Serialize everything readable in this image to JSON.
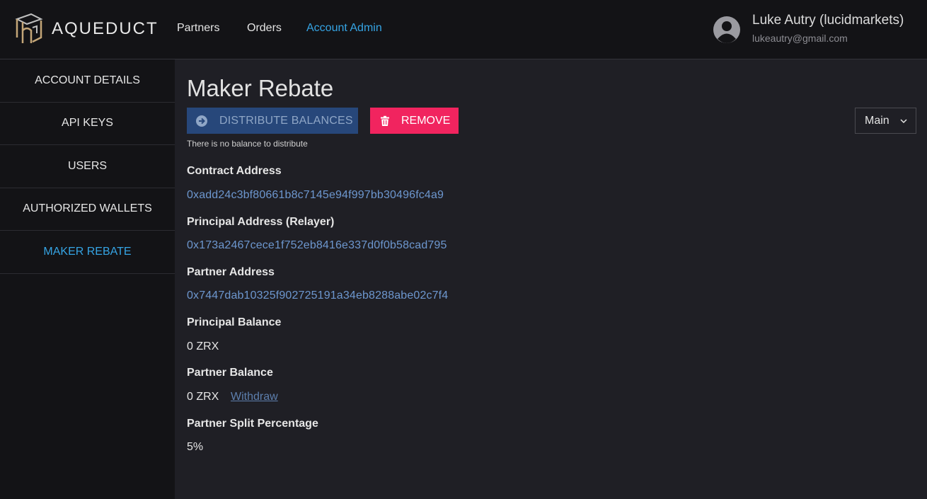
{
  "header": {
    "brand": "AQUEDUCT",
    "nav": [
      "Partners",
      "Orders",
      "Account Admin"
    ],
    "active_nav": "Account Admin",
    "user_name": "Luke Autry (lucidmarkets)",
    "user_email": "lukeautry@gmail.com",
    "icons": [
      "aqueduct-logo-icon",
      "user-avatar-icon"
    ]
  },
  "sidebar": {
    "items": [
      {
        "label": "ACCOUNT DETAILS"
      },
      {
        "label": "API KEYS"
      },
      {
        "label": "USERS"
      },
      {
        "label": "AUTHORIZED WALLETS"
      },
      {
        "label": "MAKER REBATE"
      }
    ],
    "active": "MAKER REBATE"
  },
  "main": {
    "title": "Maker Rebate",
    "distribute_label": "DISTRIBUTE BALANCES",
    "remove_label": "REMOVE",
    "distribute_note": "There is no balance to distribute",
    "network_select": "Main",
    "fields": [
      {
        "label": "Contract Address",
        "value": "0xadd24c3bf80661b8c7145e94f997bb30496fc4a9"
      },
      {
        "label": "Principal Address (Relayer)",
        "value": "0x173a2467cece1f752eb8416e337d0f0b58cad795"
      },
      {
        "label": "Partner Address",
        "value": "0x7447dab10325f902725191a34eb8288abe02c7f4"
      },
      {
        "label": "Principal Balance",
        "value": "0 ZRX"
      },
      {
        "label": "Partner Balance",
        "value": "0 ZRX",
        "action": "Withdraw"
      },
      {
        "label": "Partner Split Percentage",
        "value": "5%"
      }
    ]
  },
  "colors": {
    "accent": "#35a4e4",
    "link": "#6d97cf",
    "remove": "#f1245f",
    "distribute": "#27477a",
    "background": "#1f1f25",
    "panel": "#131316"
  }
}
